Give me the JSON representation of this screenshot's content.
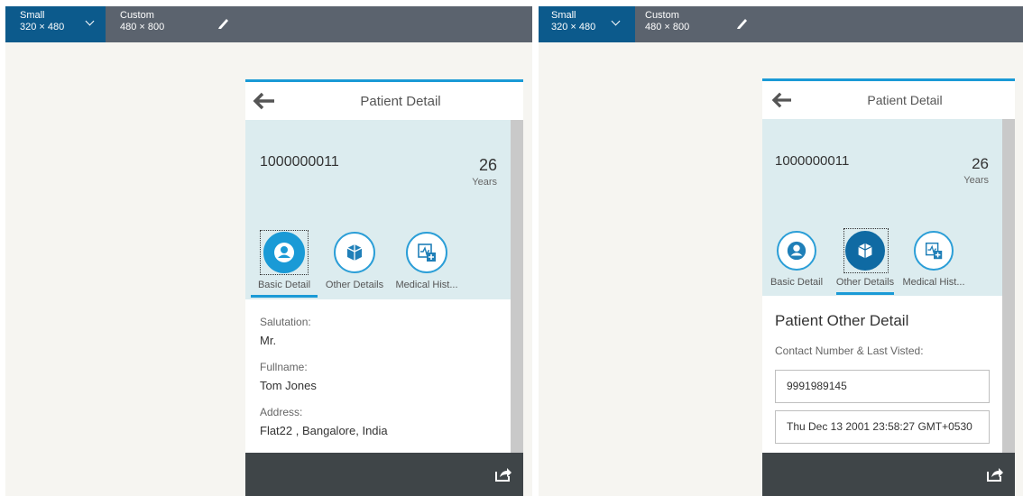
{
  "left": {
    "toolbar": {
      "small": {
        "name": "Small",
        "size": "320 × 480"
      },
      "custom": {
        "name": "Custom",
        "size": "480 × 800"
      }
    },
    "app": {
      "title": "Patient Detail",
      "object": {
        "number": "1000000011",
        "value": "26",
        "unit": "Years"
      },
      "tabs": [
        {
          "label": "Basic Detail",
          "icon": "person-icon",
          "selected": true
        },
        {
          "label": "Other Details",
          "icon": "box-icon",
          "selected": false
        },
        {
          "label": "Medical Hist...",
          "icon": "medical-history-icon",
          "selected": false
        }
      ],
      "fields": [
        {
          "label": "Salutation:",
          "value": "Mr."
        },
        {
          "label": "Fullname:",
          "value": "Tom Jones"
        },
        {
          "label": "Address:",
          "value": "Flat22 , Bangalore, India"
        }
      ]
    }
  },
  "right": {
    "toolbar": {
      "small": {
        "name": "Small",
        "size": "320 × 480"
      },
      "custom": {
        "name": "Custom",
        "size": "480 × 800"
      }
    },
    "app": {
      "title": "Patient Detail",
      "object": {
        "number": "1000000011",
        "value": "26",
        "unit": "Years"
      },
      "tabs": [
        {
          "label": "Basic Detail",
          "icon": "person-icon",
          "selected": false
        },
        {
          "label": "Other Details",
          "icon": "box-icon",
          "selected": true
        },
        {
          "label": "Medical Hist...",
          "icon": "medical-history-icon",
          "selected": false
        }
      ],
      "section_title": "Patient Other Detail",
      "contact_label": "Contact Number & Last Visted:",
      "phone_value": "9991989145",
      "last_visited_value": "Thu Dec 13 2001 23:58:27 GMT+0530"
    }
  },
  "colors": {
    "accent": "#1a9ad6",
    "toolbar": "#5b636e",
    "toolbar_active": "#0c5a8c",
    "header_bg": "#dcecef",
    "footer": "#3f4548"
  }
}
